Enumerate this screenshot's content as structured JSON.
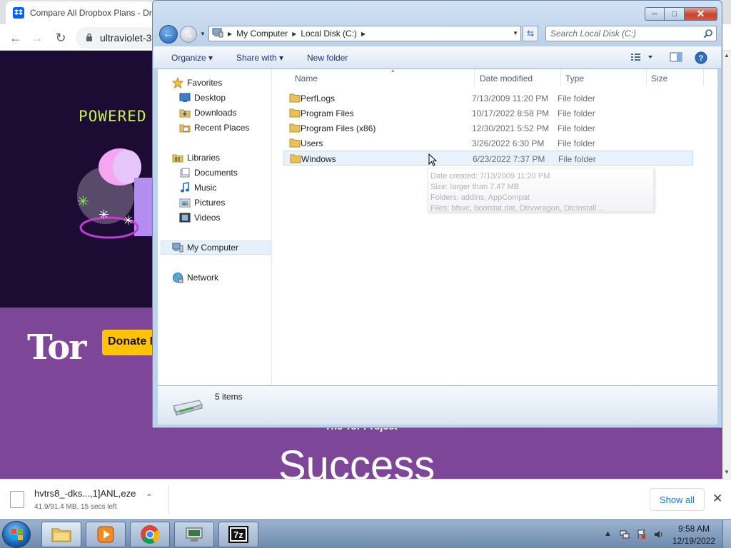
{
  "browser": {
    "tab_title": "Compare All Dropbox Plans - Dr",
    "url": "ultraviolet-3",
    "page": {
      "powered_text": "POWERED",
      "tor_logo": "Tor",
      "donate_label": "Donate N",
      "tor_project": "The Tor Project",
      "success_heading": "Success"
    },
    "download": {
      "file_name": "hvtrs8_-dks...,1]ANL,eze",
      "status": "41.9/91.4 MB, 15 secs left",
      "show_all_label": "Show all"
    }
  },
  "explorer": {
    "address": [
      "My Computer",
      "Local Disk (C:)"
    ],
    "search_placeholder": "Search Local Disk (C:)",
    "commands": {
      "organize": "Organize",
      "share_with": "Share with",
      "new_folder": "New folder"
    },
    "nav": {
      "favorites": "Favorites",
      "desktop": "Desktop",
      "downloads": "Downloads",
      "recent": "Recent Places",
      "libraries": "Libraries",
      "documents": "Documents",
      "music": "Music",
      "pictures": "Pictures",
      "videos": "Videos",
      "computer": "My Computer",
      "network": "Network"
    },
    "columns": {
      "name": "Name",
      "date": "Date modified",
      "type": "Type",
      "size": "Size"
    },
    "files": [
      {
        "name": "PerfLogs",
        "date": "7/13/2009 11:20 PM",
        "type": "File folder"
      },
      {
        "name": "Program Files",
        "date": "10/17/2022 8:58 PM",
        "type": "File folder"
      },
      {
        "name": "Program Files (x86)",
        "date": "12/30/2021 5:52 PM",
        "type": "File folder"
      },
      {
        "name": "Users",
        "date": "3/26/2022 6:30 PM",
        "type": "File folder"
      },
      {
        "name": "Windows",
        "date": "6/23/2022 7:37 PM",
        "type": "File folder"
      }
    ],
    "tooltip": {
      "created": "Date created: 7/13/2009 11:20 PM",
      "size": "Size: larger than 7.47 MB",
      "folders": "Folders: addins, AppCompat",
      "files": "Files: bfsvc, bootstat.dat, Dtrvwragon, DtcInstall ..."
    },
    "status": "5 items"
  },
  "taskbar": {
    "time": "9:58 AM",
    "date": "12/19/2022",
    "apps": [
      "explorer",
      "media-player",
      "chrome",
      "network-tool",
      "7zip"
    ],
    "seven_zip_label": "7z"
  },
  "colors": {
    "page_dark": "#1c0c33",
    "page_purple": "#7d4698",
    "accent_green": "#c8f14b",
    "donate_yellow": "#ffc300",
    "folder_yellow": "#e8c15a",
    "explorer_blue": "#bcd3ed"
  }
}
